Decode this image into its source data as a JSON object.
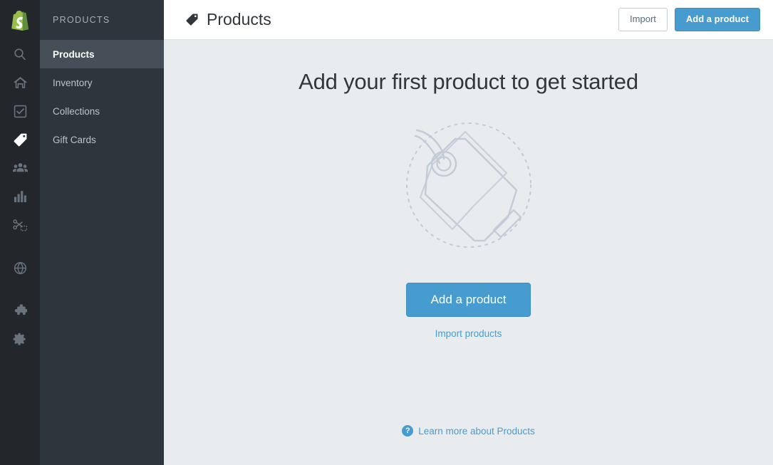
{
  "brand": {
    "logo_icon": "shopify-bag-logo",
    "logo_color": "#95bf47"
  },
  "rail": {
    "items": [
      {
        "icon": "search-icon",
        "name": "search",
        "active": false
      },
      {
        "icon": "home-icon",
        "name": "home",
        "active": false
      },
      {
        "icon": "orders-checkbox-icon",
        "name": "orders",
        "active": false
      },
      {
        "icon": "products-tag-icon",
        "name": "products",
        "active": true
      },
      {
        "icon": "customers-people-icon",
        "name": "customers",
        "active": false
      },
      {
        "icon": "analytics-bar-chart-icon",
        "name": "analytics",
        "active": false
      },
      {
        "icon": "discounts-scissors-icon",
        "name": "discounts",
        "active": false
      },
      {
        "icon": "online-store-globe-icon",
        "name": "online-store",
        "active": false
      },
      {
        "icon": "apps-puzzle-icon",
        "name": "apps",
        "active": false
      },
      {
        "icon": "settings-gear-icon",
        "name": "settings",
        "active": false
      }
    ]
  },
  "sidebar": {
    "title": "PRODUCTS",
    "items": [
      {
        "label": "Products",
        "active": true
      },
      {
        "label": "Inventory",
        "active": false
      },
      {
        "label": "Collections",
        "active": false
      },
      {
        "label": "Gift Cards",
        "active": false
      }
    ]
  },
  "header": {
    "icon": "tag-icon",
    "title": "Products",
    "import_label": "Import",
    "add_product_label": "Add a product"
  },
  "empty_state": {
    "heading": "Add your first product to get started",
    "illustration": "product-tags-dashed-circle-illustration",
    "cta_label": "Add a product",
    "secondary_link": "Import products"
  },
  "footer": {
    "help_icon": "question-mark-icon",
    "learn_more": "Learn more about Products"
  },
  "colors": {
    "accent_blue": "#479ccf",
    "rail_bg": "#23272b",
    "subnav_bg": "#2f353d",
    "subnav_active_bg": "#464f58",
    "content_bg": "#e9ecee",
    "illustration_stroke": "#c3cbd6"
  }
}
